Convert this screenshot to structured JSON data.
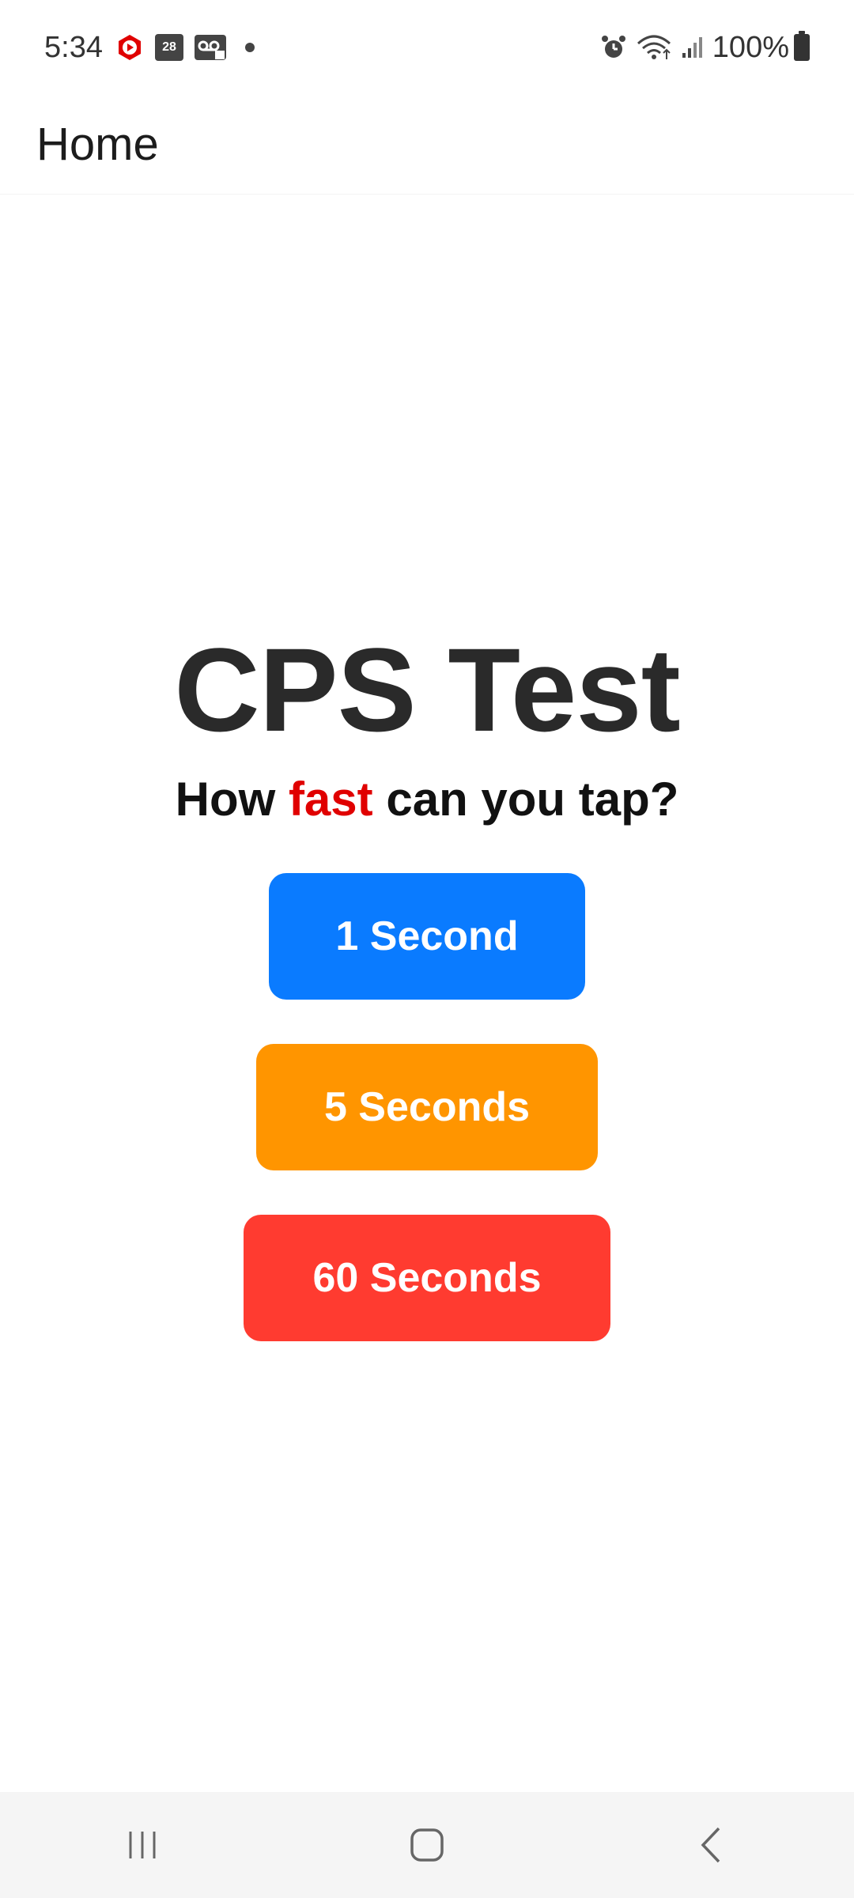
{
  "status_bar": {
    "time": "5:34",
    "calendar_day": "28",
    "battery": "100%",
    "icons": [
      "youtube-icon",
      "calendar-icon",
      "voicemail-icon",
      "dot-icon",
      "alarm-icon",
      "wifi-icon",
      "signal-icon",
      "battery-icon"
    ]
  },
  "app_bar": {
    "title": "Home"
  },
  "main": {
    "title": "CPS Test",
    "subtitle_prefix": "How ",
    "subtitle_accent": "fast",
    "subtitle_suffix": " can you tap?",
    "buttons": [
      {
        "label": "1 Second",
        "color": "#0a7bff"
      },
      {
        "label": "5 Seconds",
        "color": "#ff9500"
      },
      {
        "label": "60 Seconds",
        "color": "#ff3b30"
      }
    ]
  },
  "nav_bar": {
    "icons": [
      "recents-icon",
      "home-icon",
      "back-icon"
    ]
  },
  "colors": {
    "accent_red": "#e00000",
    "title_text": "#2a2a2a"
  }
}
